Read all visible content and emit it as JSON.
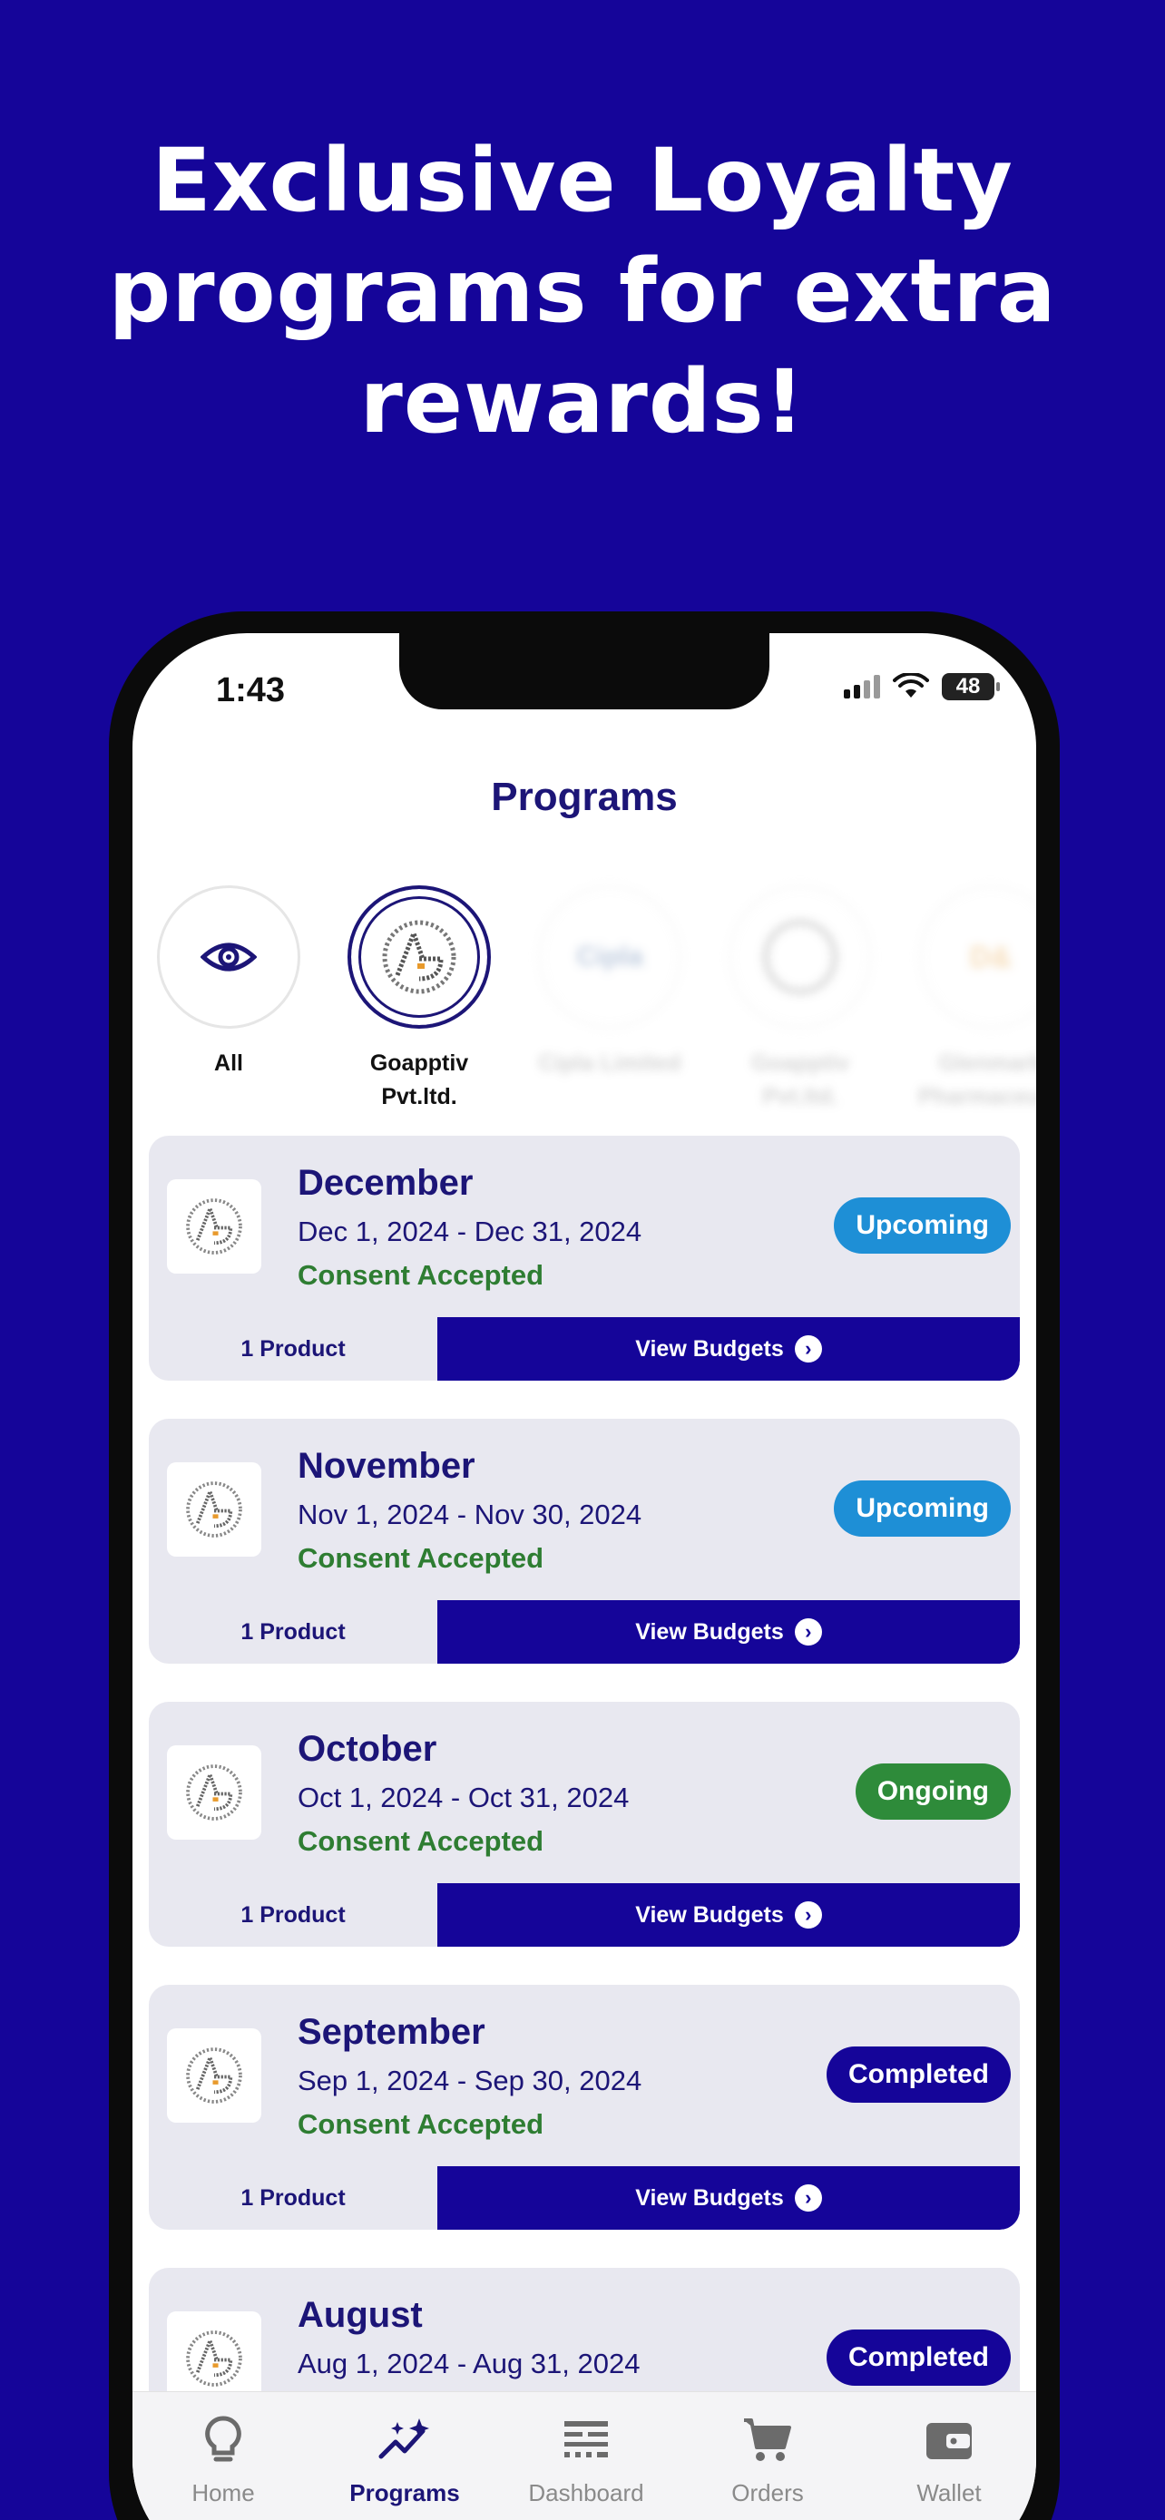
{
  "headline": {
    "line1": "Exclusive Loyalty",
    "line2": "programs for extra",
    "line3": "rewards!"
  },
  "status_bar": {
    "time": "1:43",
    "battery": "48"
  },
  "page_title": "Programs",
  "filters": [
    {
      "label": "All",
      "icon": "eye-icon"
    },
    {
      "label_line1": "Goapptiv",
      "label_line2": "Pvt.ltd.",
      "icon": "goapptiv-logo"
    },
    {
      "label": "Cipla Limited",
      "icon": "cipla-logo"
    },
    {
      "label": "Goapptiv Pvt.ltd.",
      "icon": "goapptiv-logo"
    },
    {
      "label": "Glenmark Pharmaceuticals",
      "icon": "glenmark-logo"
    }
  ],
  "programs": [
    {
      "month": "December",
      "range": "Dec 1, 2024 - Dec 31, 2024",
      "consent": "Consent Accepted",
      "status": "Upcoming",
      "products": "1 Product",
      "action": "View Budgets"
    },
    {
      "month": "November",
      "range": "Nov 1, 2024 - Nov 30, 2024",
      "consent": "Consent Accepted",
      "status": "Upcoming",
      "products": "1 Product",
      "action": "View Budgets"
    },
    {
      "month": "October",
      "range": "Oct 1, 2024 - Oct 31, 2024",
      "consent": "Consent Accepted",
      "status": "Ongoing",
      "products": "1 Product",
      "action": "View Budgets"
    },
    {
      "month": "September",
      "range": "Sep 1, 2024 - Sep 30, 2024",
      "consent": "Consent Accepted",
      "status": "Completed",
      "products": "1 Product",
      "action": "View Budgets"
    },
    {
      "month": "August",
      "range": "Aug 1, 2024 - Aug 31, 2024",
      "status": "Completed"
    }
  ],
  "status_colors": {
    "Upcoming": "#1e8fd6",
    "Ongoing": "#2e8b3a",
    "Completed": "#150599"
  },
  "tabs": [
    {
      "label": "Home",
      "icon": "lightbulb-icon"
    },
    {
      "label": "Programs",
      "icon": "sparkle-chart-icon"
    },
    {
      "label": "Dashboard",
      "icon": "dashboard-icon"
    },
    {
      "label": "Orders",
      "icon": "cart-icon"
    },
    {
      "label": "Wallet",
      "icon": "wallet-icon"
    }
  ],
  "active_tab": "Programs",
  "colors": {
    "brand": "#150599",
    "title": "#1c1577",
    "consent": "#2e7d32"
  }
}
